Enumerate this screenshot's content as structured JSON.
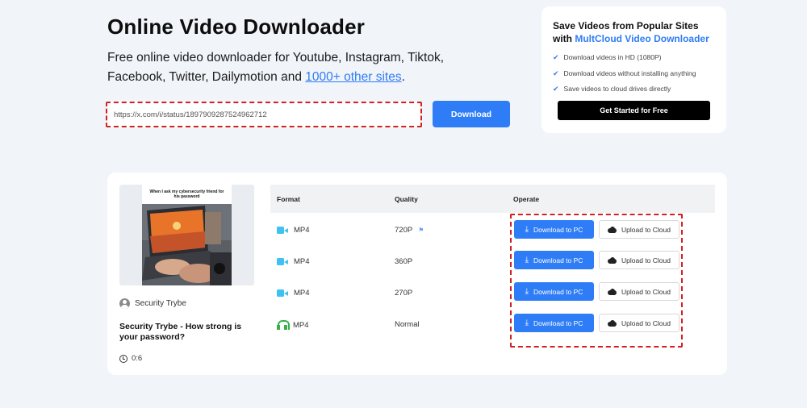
{
  "hero": {
    "title": "Online Video Downloader",
    "desc_prefix": "Free online video downloader for Youtube, Instagram, Tiktok, Facebook, Twitter, Dailymotion and ",
    "desc_link": "1000+ other sites",
    "desc_suffix": "."
  },
  "search": {
    "url_value": "https://x.com/i/status/1897909287524962712",
    "download_label": "Download"
  },
  "promo": {
    "title_line1": "Save Videos from Popular Sites",
    "title_with": "with ",
    "brand": "MultCloud Video Downloader",
    "features": [
      "Download videos in HD (1080P)",
      "Download videos without installing anything",
      "Save videos to cloud drives directly"
    ],
    "cta_label": "Get Started for Free"
  },
  "video": {
    "thumbnail_caption": "When I ask my cybersecurity friend for his password",
    "author": "Security Trybe",
    "title": "Security Trybe - How strong is your password?",
    "duration": "0:6"
  },
  "table": {
    "headers": {
      "format": "Format",
      "quality": "Quality",
      "operate": "Operate"
    },
    "rows": [
      {
        "format": "MP4",
        "quality": "720P",
        "icon": "video-camera-icon"
      },
      {
        "format": "MP4",
        "quality": "360P",
        "icon": "video-camera-icon"
      },
      {
        "format": "MP4",
        "quality": "270P",
        "icon": "video-camera-icon"
      },
      {
        "format": "MP4",
        "quality": "Normal",
        "icon": "headphones-icon"
      }
    ],
    "download_pc_label": "Download to PC",
    "upload_cloud_label": "Upload to Cloud"
  },
  "colors": {
    "accent": "#2f7df6",
    "highlight": "#d42020",
    "background": "#f1f4f9"
  }
}
